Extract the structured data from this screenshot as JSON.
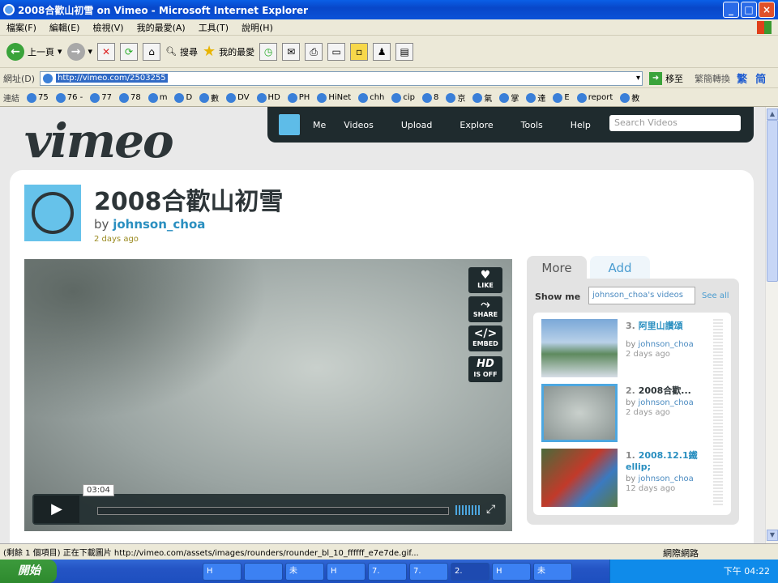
{
  "window": {
    "title": "2008合歡山初雪 on Vimeo - Microsoft Internet Explorer"
  },
  "menubar": [
    "檔案(F)",
    "編輯(E)",
    "檢視(V)",
    "我的最愛(A)",
    "工具(T)",
    "說明(H)"
  ],
  "toolbar": {
    "back_label": "上一頁",
    "search_label": "搜尋",
    "favorites_label": "我的最愛"
  },
  "address": {
    "label": "網址(D)",
    "url": "http://vimeo.com/2503255",
    "go_label": "移至",
    "convert_label": "繁簡轉換",
    "trad": "繁",
    "simp": "简"
  },
  "links": {
    "label": "連結",
    "items": [
      "75",
      "76 -",
      "77",
      "78",
      "m",
      "D",
      "數",
      "DV",
      "HD",
      "PH",
      "HiNet",
      "chh",
      "cip",
      "8",
      "京",
      "氣",
      "掌",
      "達",
      "E",
      "report",
      "教"
    ]
  },
  "vimeo": {
    "logo": "vimeo",
    "nav": [
      "Me",
      "Videos",
      "Upload",
      "Explore",
      "Tools",
      "Help"
    ],
    "search_placeholder": "Search Videos"
  },
  "video": {
    "title": "2008合歡山初雪",
    "by_prefix": "by",
    "author": "johnson_choa",
    "posted": "2 days ago",
    "buttons": {
      "like": "LIKE",
      "share": "SHARE",
      "embed": "EMBED",
      "hd": "HD",
      "hd_sub": "IS OFF"
    },
    "duration": "03:04"
  },
  "sidebar": {
    "tab_more": "More",
    "tab_add": "Add",
    "show_me": "Show me",
    "selector": "johnson_choa's videos",
    "see_all": "See all",
    "items": [
      {
        "num": "3.",
        "title": "阿里山讚頌",
        "by": "by",
        "user": "johnson_choa",
        "ago": "2 days ago"
      },
      {
        "num": "2.",
        "title": "2008合歡...",
        "by": "by",
        "user": "johnson_choa",
        "ago": "2 days ago"
      },
      {
        "num": "1.",
        "title": "2008.12.1鐵 ellip;",
        "by": "by",
        "user": "johnson_choa",
        "ago": "12 days ago"
      }
    ]
  },
  "status": {
    "text": "(剩餘 1 個項目) 正在下載圖片 http://vimeo.com/assets/images/rounders/rounder_bl_10_ffffff_e7e7de.gif...",
    "zone": "網際網路"
  },
  "taskbar": {
    "start": "開始",
    "tasks": [
      "H",
      "",
      "未",
      "H",
      "7.",
      "7.",
      "2.",
      "H",
      "未"
    ],
    "clock": "下午 04:22"
  },
  "colors": {
    "accent": "#4a9cd0",
    "nav_bg": "#1f2b2e",
    "avatar": "#66c2ea"
  }
}
